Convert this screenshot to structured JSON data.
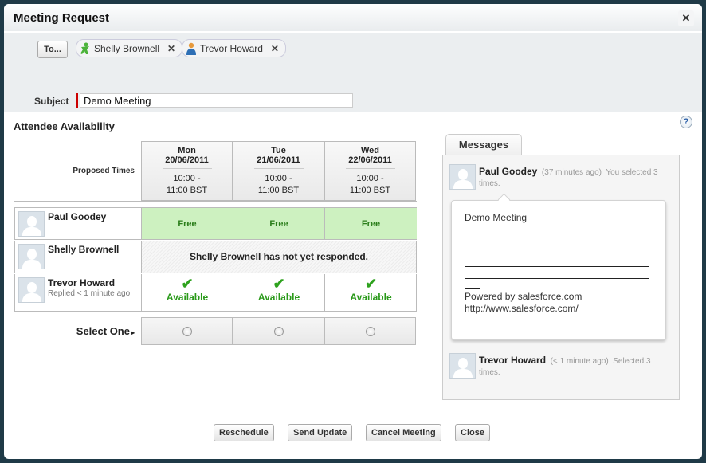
{
  "dialog": {
    "title": "Meeting Request",
    "close_glyph": "✕"
  },
  "recipients": {
    "to_label": "To...",
    "chips": [
      {
        "name": "Shelly Brownell",
        "icon": "contact-icon",
        "remove_glyph": "✕"
      },
      {
        "name": "Trevor Howard",
        "icon": "user-icon",
        "remove_glyph": "✕"
      }
    ]
  },
  "subject": {
    "label": "Subject",
    "value": "Demo Meeting"
  },
  "availability": {
    "title": "Attendee Availability",
    "help_glyph": "?",
    "proposed_label": "Proposed Times",
    "times": [
      {
        "day": "Mon",
        "date": "20/06/2011",
        "start": "10:00 -",
        "end": "11:00 BST"
      },
      {
        "day": "Tue",
        "date": "21/06/2011",
        "start": "10:00 -",
        "end": "11:00 BST"
      },
      {
        "day": "Wed",
        "date": "22/06/2011",
        "start": "10:00 -",
        "end": "11:00 BST"
      }
    ],
    "attendees": [
      {
        "name": "Paul Goodey",
        "status": [
          "Free",
          "Free",
          "Free"
        ]
      },
      {
        "name": "Shelly Brownell",
        "pending": "Shelly Brownell has not yet responded."
      },
      {
        "name": "Trevor Howard",
        "sub": "Replied < 1 minute ago.",
        "status": [
          "Available",
          "Available",
          "Available"
        ],
        "check_glyph": "✔"
      }
    ],
    "select_label": "Select One",
    "select_arrow": "▸"
  },
  "messages": {
    "tab_label": "Messages",
    "items": [
      {
        "name": "Paul Goodey",
        "time": "(37 minutes ago)",
        "note": "You selected 3 times.",
        "body": {
          "subject": "Demo Meeting",
          "powered": "Powered by salesforce.com",
          "url": "http://www.salesforce.com/"
        }
      },
      {
        "name": "Trevor Howard",
        "time": "(< 1 minute ago)",
        "note": "Selected 3 times."
      }
    ]
  },
  "footer": {
    "buttons": [
      "Reschedule",
      "Send Update",
      "Cancel Meeting",
      "Close"
    ]
  }
}
